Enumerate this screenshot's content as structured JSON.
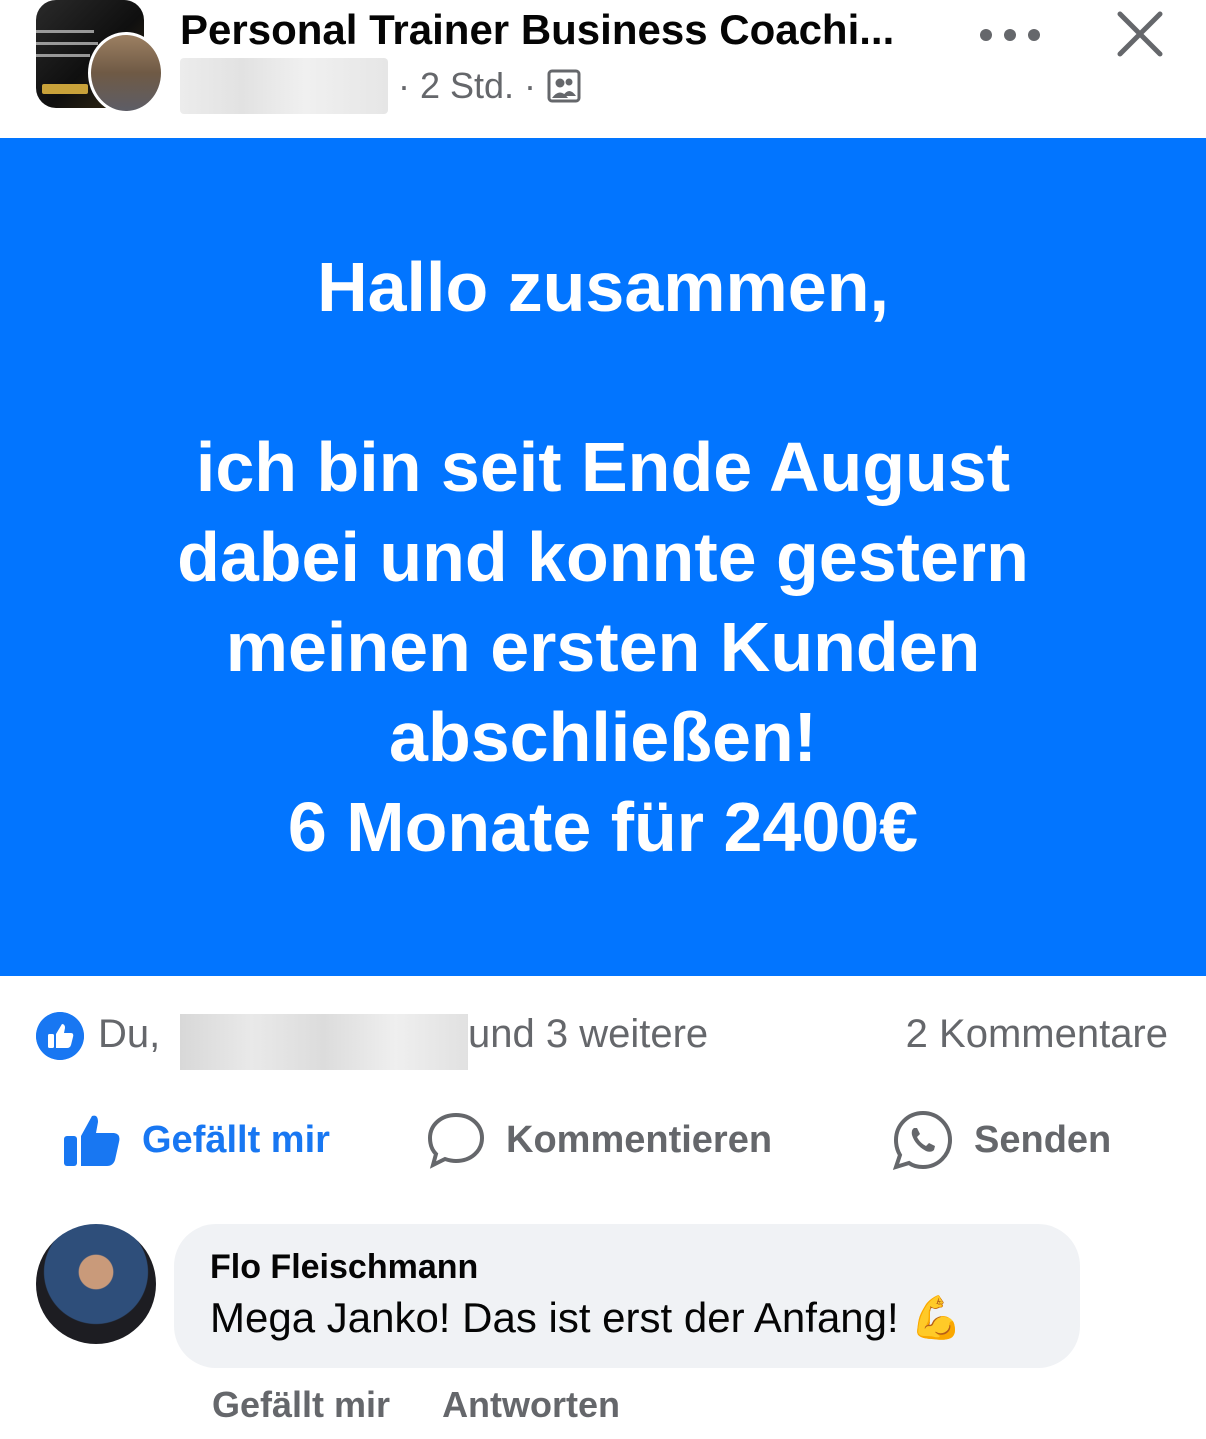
{
  "header": {
    "group_name": "Personal Trainer Business Coachi...",
    "time": "· 2 Std. ·",
    "audience_icon": "group-audience-icon",
    "more_icon": "more-dots-icon",
    "close_icon": "close-icon"
  },
  "post": {
    "background_color": "#0275ff",
    "text": "Hallo zusammen,\n\nich bin seit Ende August dabei und konnte gestern meinen ersten Kunden abschließen!\n6 Monate für 2400€"
  },
  "reactions": {
    "icon": "like-reaction-icon",
    "prefix": "Du,",
    "suffix": "und 3 weitere",
    "comments_count": "2 Kommentare"
  },
  "actions": {
    "like_label": "Gefällt mir",
    "comment_label": "Kommentieren",
    "send_label": "Senden"
  },
  "comment": {
    "author": "Flo Fleischmann",
    "text": "Mega Janko! Das ist erst der Anfang!",
    "emoji": "💪",
    "like_label": "Gefällt mir",
    "reply_label": "Antworten"
  },
  "colors": {
    "accent": "#1877f2",
    "secondary_text": "#65676b",
    "bubble": "#f0f2f5"
  }
}
